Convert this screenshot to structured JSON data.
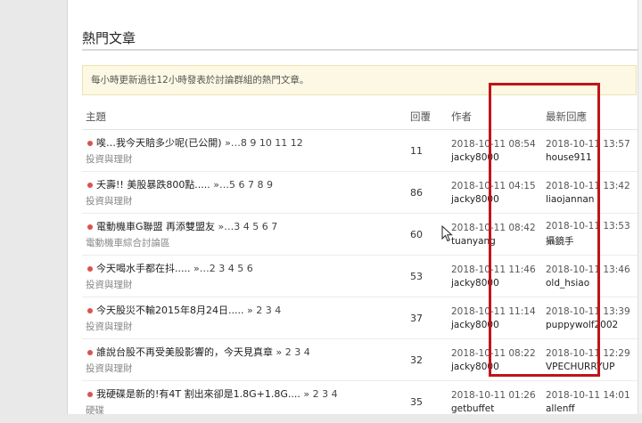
{
  "section": {
    "title": "熱門文章"
  },
  "notice": {
    "text": "每小時更新過往12小時發表於討論群組的熱門文章。"
  },
  "table": {
    "headers": {
      "topic": "主題",
      "replies": "回覆",
      "author": "作者",
      "last_reply": "最新回應"
    },
    "rows": [
      {
        "title": "唉…我今天賠多少呢(已公開)",
        "pages": "»…8 9 10 11 12",
        "forum": "投資與理財",
        "replies": "11",
        "author_time": "2018-10-11 08:54",
        "author": "jacky8000",
        "last_time": "2018-10-11 13:57",
        "last_user": "house911"
      },
      {
        "title": "夭壽!! 美股暴跌800點.....",
        "pages": "»…5 6 7 8 9",
        "forum": "投資與理財",
        "replies": "86",
        "author_time": "2018-10-11 04:15",
        "author": "jacky8000",
        "last_time": "2018-10-11 13:42",
        "last_user": "liaojannan"
      },
      {
        "title": "電動機車G聯盟 再添雙盟友",
        "pages": "»…3 4 5 6 7",
        "forum": "電動機車綜合討論區",
        "replies": "60",
        "author_time": "2018-10-11 08:42",
        "author": "tuanyang",
        "last_time": "2018-10-11 13:53",
        "last_user": "攝鏡手"
      },
      {
        "title": "今天喝水手都在抖.....",
        "pages": "»…2 3 4 5 6",
        "forum": "投資與理財",
        "replies": "53",
        "author_time": "2018-10-11 11:46",
        "author": "jacky8000",
        "last_time": "2018-10-11 13:46",
        "last_user": "old_hsiao"
      },
      {
        "title": "今天股災不輸2015年8月24日.....",
        "pages": "» 2 3 4",
        "forum": "投資與理財",
        "replies": "37",
        "author_time": "2018-10-11 11:14",
        "author": "jacky8000",
        "last_time": "2018-10-11 13:39",
        "last_user": "puppywolf2002"
      },
      {
        "title": "誰說台股不再受美股影響的，今天見真章",
        "pages": "» 2 3 4",
        "forum": "投資與理財",
        "replies": "32",
        "author_time": "2018-10-11 08:22",
        "author": "jacky8000",
        "last_time": "2018-10-11 12:29",
        "last_user": "VPECHURRYUP"
      },
      {
        "title": "我硬碟是新的!有4T 割出來卻是1.8G+1.8G....",
        "pages": "» 2 3 4",
        "forum": "硬碟",
        "replies": "35",
        "author_time": "2018-10-11 01:26",
        "author": "getbuffet",
        "last_time": "2018-10-11 14:01",
        "last_user": "allenff"
      }
    ]
  },
  "colors": {
    "highlight": "#c0141b",
    "bullet": "#d9534f",
    "notice_bg": "#fcf8e3"
  },
  "icons": {
    "bullet": "red-dot-icon",
    "cursor": "mouse-pointer-icon"
  }
}
